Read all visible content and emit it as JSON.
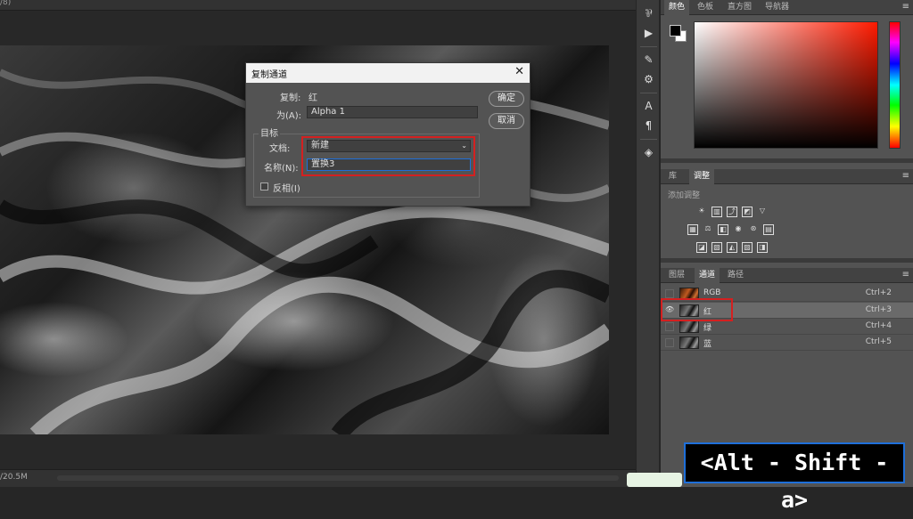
{
  "document": {
    "tab_label": "/8)",
    "file_size": "/20.5M"
  },
  "dialog": {
    "title": "复制通道",
    "source_label": "复制:",
    "source_value": "红",
    "as_label": "为(A):",
    "as_value": "Alpha 1",
    "target_group_label": "目标",
    "document_label": "文档:",
    "document_value": "新建",
    "name_label": "名称(N):",
    "name_value": "置换3",
    "invert_label": "反相(I)",
    "ok_label": "确定",
    "cancel_label": "取消"
  },
  "color_panel": {
    "tabs": [
      "颜色",
      "色板",
      "直方图",
      "导航器"
    ],
    "active_tab": "颜色",
    "foreground": "#000000",
    "background": "#ffffff",
    "hue": "#ff1a00"
  },
  "adjustments_panel": {
    "tabs": [
      "库",
      "调整"
    ],
    "active_tab": "调整",
    "hint": "添加调整"
  },
  "channels_panel": {
    "tabs": [
      "图层",
      "通道",
      "路径"
    ],
    "active_tab": "通道",
    "channels": [
      {
        "name": "RGB",
        "shortcut": "Ctrl+2",
        "visible": false,
        "selected": false
      },
      {
        "name": "红",
        "shortcut": "Ctrl+3",
        "visible": true,
        "selected": true
      },
      {
        "name": "绿",
        "shortcut": "Ctrl+4",
        "visible": false,
        "selected": false
      },
      {
        "name": "蓝",
        "shortcut": "Ctrl+5",
        "visible": false,
        "selected": false
      }
    ]
  },
  "keystroke_overlay": {
    "text": "<Alt - Shift - a>"
  },
  "colors": {
    "highlight_red": "#d42020",
    "overlay_blue": "#1e6fd9"
  }
}
